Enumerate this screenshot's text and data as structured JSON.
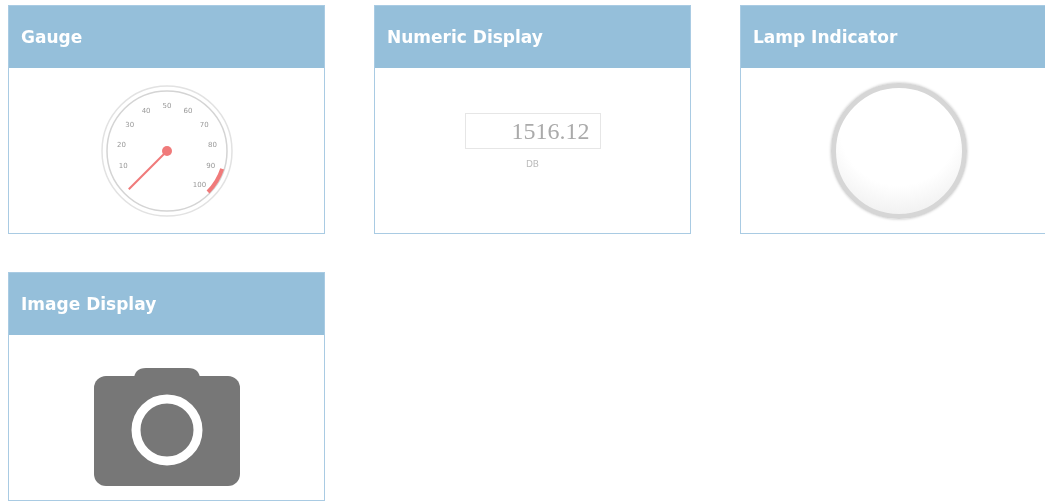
{
  "widgets": [
    {
      "kind": "gauge",
      "title": "Gauge",
      "labels": [
        "10",
        "20",
        "30",
        "40",
        "50",
        "60",
        "70",
        "80",
        "90",
        "100"
      ]
    },
    {
      "kind": "numeric",
      "title": "Numeric Display",
      "value": "1516.12",
      "unit": "DB"
    },
    {
      "kind": "lamp",
      "title": "Lamp Indicator",
      "on": false
    },
    {
      "kind": "image",
      "title": "Image Display"
    }
  ]
}
